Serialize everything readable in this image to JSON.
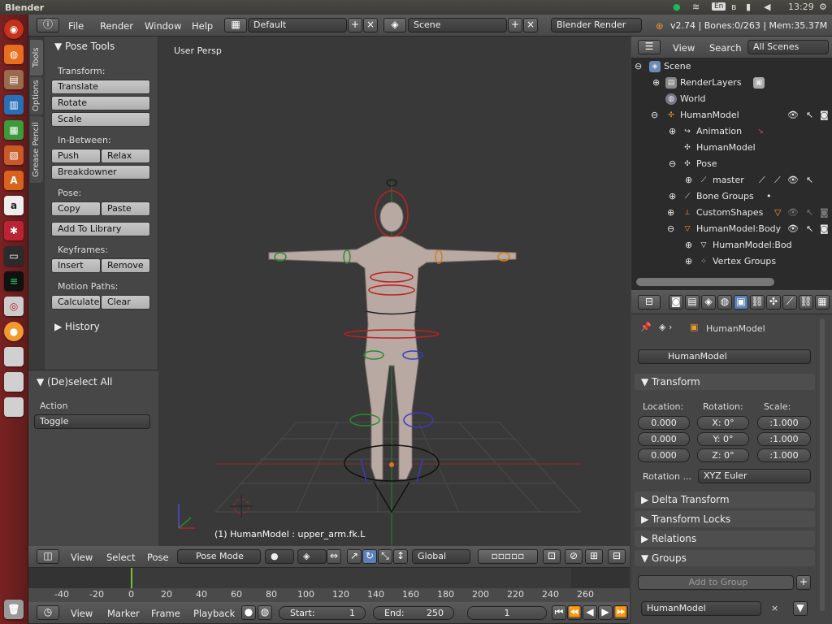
{
  "system_bar": {
    "app_title": "Blender",
    "time": "13:29",
    "keyboard": "En"
  },
  "launcher": {
    "icons": [
      "ubuntu-logo-icon",
      "firefox-icon",
      "files-icon",
      "writer-icon",
      "calc-icon",
      "impress-icon",
      "software-center-icon",
      "amazon-icon",
      "settings-icon",
      "terminal-icon",
      "spotify-icon",
      "disk-icon",
      "blender-icon",
      "drive-icon",
      "drive-icon",
      "drive-icon",
      "trash-icon"
    ]
  },
  "topbar": {
    "menus": [
      "File",
      "Render",
      "Window",
      "Help"
    ],
    "screen_layout": "Default",
    "scene": "Scene",
    "render_engine": "Blender Render",
    "stats": "v2.74 | Bones:0/263 | Mem:35.37M"
  },
  "tool_shelf": {
    "tabs": [
      "Tools",
      "Options",
      "Grease Pencil"
    ],
    "panel_title": "Pose Tools",
    "transform_label": "Transform:",
    "transform_buttons": [
      "Translate",
      "Rotate",
      "Scale"
    ],
    "inbetween_label": "In-Between:",
    "push": "Push",
    "relax": "Relax",
    "breakdowner": "Breakdowner",
    "pose_label": "Pose:",
    "copy": "Copy",
    "paste": "Paste",
    "add_to_library": "Add To Library",
    "keyframes_label": "Keyframes:",
    "insert": "Insert",
    "remove": "Remove",
    "motion_label": "Motion Paths:",
    "calculate": "Calculate",
    "clear": "Clear",
    "history": "History",
    "operator_title": "(De)select All",
    "action_label": "Action",
    "action_value": "Toggle"
  },
  "viewport": {
    "view_label": "User Persp",
    "status": "(1) HumanModel : upper_arm.fk.L"
  },
  "viewport_header": {
    "menus": [
      "View",
      "Select",
      "Pose"
    ],
    "mode": "Pose Mode",
    "orientation": "Global"
  },
  "timeline": {
    "ticks": [
      "-40",
      "-20",
      "0",
      "20",
      "40",
      "60",
      "80",
      "100",
      "120",
      "140",
      "160",
      "180",
      "200",
      "220",
      "240",
      "260"
    ],
    "current_frame": "1"
  },
  "timeline_header": {
    "menus": [
      "View",
      "Marker",
      "Frame",
      "Playback"
    ],
    "start_label": "Start:",
    "start": "1",
    "end_label": "End:",
    "end": "250",
    "frame": "1"
  },
  "outliner": {
    "menus": [
      "View",
      "Search"
    ],
    "filter": "All Scenes",
    "rows": [
      {
        "label": "Scene",
        "indent": 0
      },
      {
        "label": "RenderLayers",
        "indent": 1
      },
      {
        "label": "World",
        "indent": 1
      },
      {
        "label": "HumanModel",
        "indent": 1
      },
      {
        "label": "Animation",
        "indent": 2
      },
      {
        "label": "HumanModel",
        "indent": 2
      },
      {
        "label": "Pose",
        "indent": 2
      },
      {
        "label": "master",
        "indent": 3
      },
      {
        "label": "Bone Groups",
        "indent": 2
      },
      {
        "label": "CustomShapes",
        "indent": 1
      },
      {
        "label": "HumanModel:Body",
        "indent": 1
      },
      {
        "label": "HumanModel:Bod",
        "indent": 2
      },
      {
        "label": "Vertex Groups",
        "indent": 2
      }
    ]
  },
  "properties": {
    "breadcrumb": "HumanModel",
    "object_name": "HumanModel",
    "transform_title": "Transform",
    "location_label": "Location:",
    "rotation_label": "Rotation:",
    "scale_label": "Scale:",
    "loc": [
      "0.000",
      "0.000",
      "0.000"
    ],
    "rot_axes": [
      "X:",
      "Y:",
      "Z:"
    ],
    "rot": [
      "0°",
      "0°",
      "0°"
    ],
    "scale": [
      ":1.000",
      ":1.000",
      ":1.000"
    ],
    "rotation_mode_label": "Rotation ...",
    "rotation_mode": "XYZ Euler",
    "delta": "Delta Transform",
    "locks": "Transform Locks",
    "relations": "Relations",
    "groups": "Groups",
    "add_to_group": "Add to Group",
    "group_name": "HumanModel"
  }
}
